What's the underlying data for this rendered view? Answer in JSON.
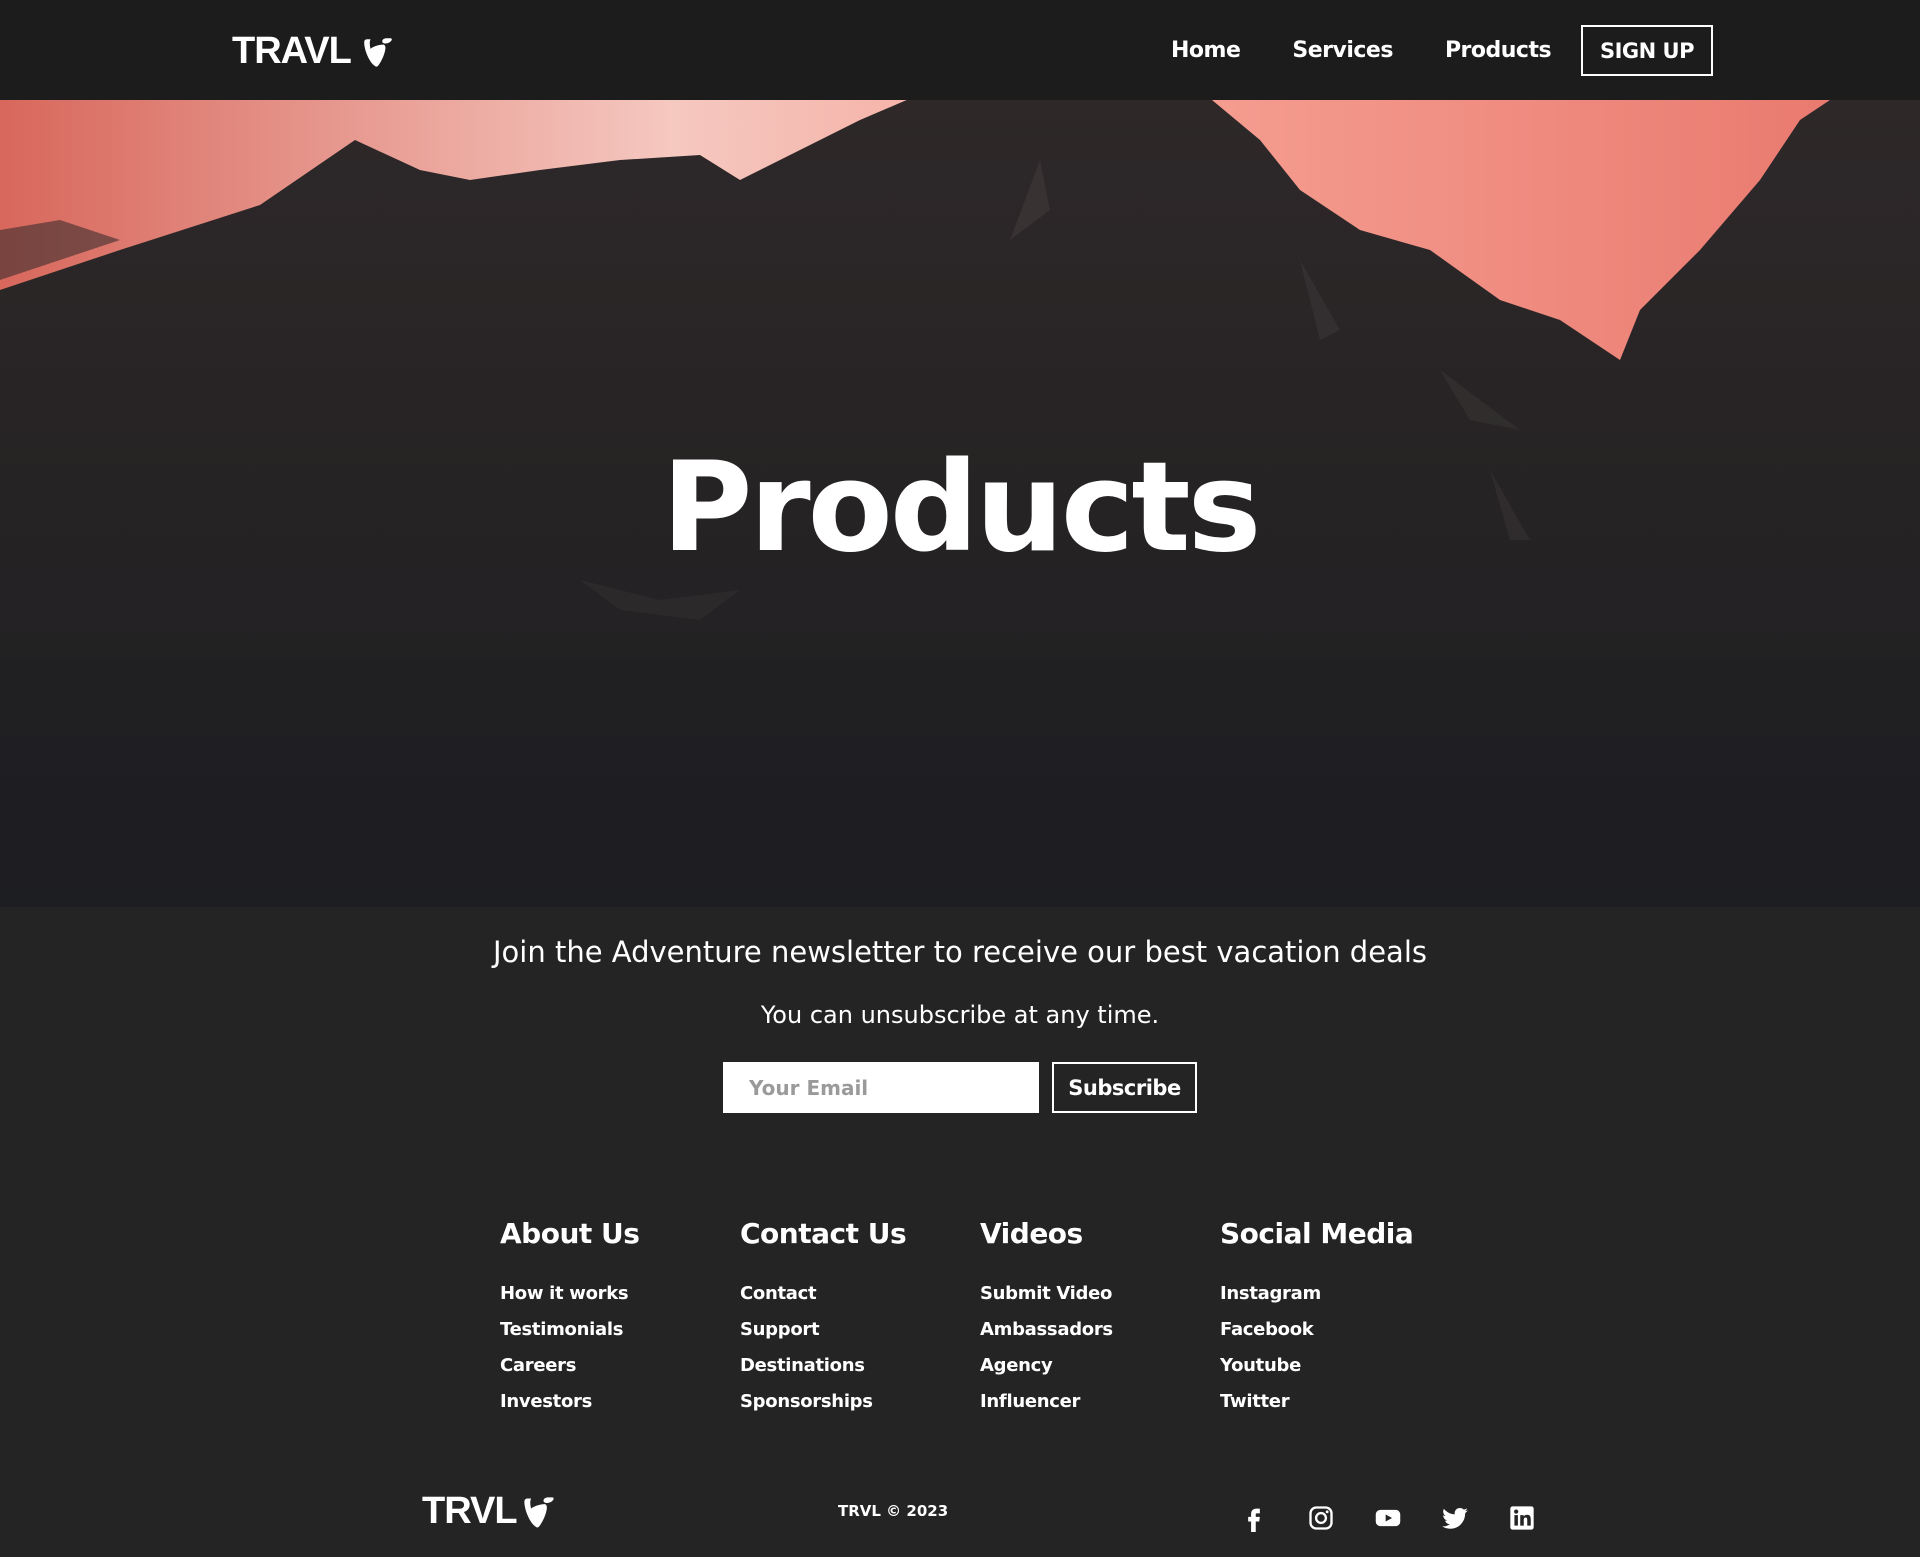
{
  "brand": {
    "name": "TRAVL",
    "footer_name": "TRVL"
  },
  "nav": {
    "items": [
      {
        "label": "Home"
      },
      {
        "label": "Services"
      },
      {
        "label": "Products"
      }
    ],
    "signup_label": "SIGN UP"
  },
  "hero": {
    "title": "Products"
  },
  "newsletter": {
    "heading": "Join the Adventure newsletter to receive our best vacation deals",
    "subtext": "You can unsubscribe at any time.",
    "email_placeholder": "Your Email",
    "subscribe_label": "Subscribe"
  },
  "footer": {
    "columns": [
      {
        "title": "About Us",
        "links": [
          "How it works",
          "Testimonials",
          "Careers",
          "Investors"
        ]
      },
      {
        "title": "Contact Us",
        "links": [
          "Contact",
          "Support",
          "Destinations",
          "Sponsorships"
        ]
      },
      {
        "title": "Videos",
        "links": [
          "Submit Video",
          "Ambassadors",
          "Agency",
          "Influencer"
        ]
      },
      {
        "title": "Social Media",
        "links": [
          "Instagram",
          "Facebook",
          "Youtube",
          "Twitter"
        ]
      }
    ],
    "copyright": "TRVL © 2023",
    "social_icons": [
      "facebook-icon",
      "instagram-icon",
      "youtube-icon",
      "twitter-icon",
      "linkedin-icon"
    ]
  },
  "colors": {
    "navbar_bg": "#1c1c1c",
    "page_bg": "#242424",
    "sky_glow": "#f27a6e",
    "text": "#ffffff"
  }
}
